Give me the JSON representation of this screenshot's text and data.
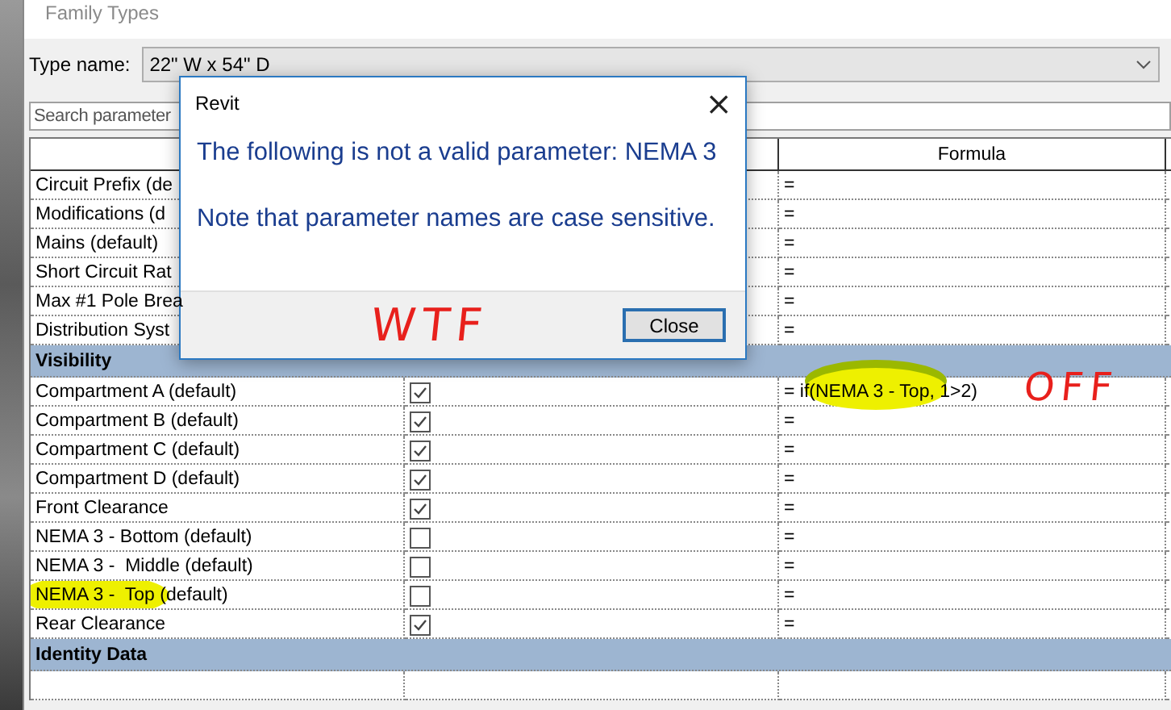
{
  "window": {
    "title": "Family Types"
  },
  "type_name": {
    "label": "Type name:",
    "value": "22\" W x 54\" D"
  },
  "search": {
    "placeholder": "Search parameter"
  },
  "table": {
    "formula_header": "Formula",
    "rows": [
      {
        "kind": "param",
        "name": "Circuit Prefix (de",
        "formula": "="
      },
      {
        "kind": "param",
        "name": "Modifications (d",
        "formula": "="
      },
      {
        "kind": "param",
        "name": "Mains (default)",
        "formula": "="
      },
      {
        "kind": "param",
        "name": "Short Circuit Rat",
        "formula": "="
      },
      {
        "kind": "param",
        "name": "Max #1 Pole Brea",
        "formula": "="
      },
      {
        "kind": "param",
        "name": "Distribution Syst",
        "formula": "="
      },
      {
        "kind": "section",
        "name": "Visibility"
      },
      {
        "kind": "check",
        "name": "Compartment A (default)",
        "checked": true,
        "formula": "= if(NEMA 3 - Top, 1>2)",
        "formula_highlight": true,
        "annotation": "OFF"
      },
      {
        "kind": "check",
        "name": "Compartment B (default)",
        "checked": true,
        "formula": "="
      },
      {
        "kind": "check",
        "name": "Compartment C (default)",
        "checked": true,
        "formula": "="
      },
      {
        "kind": "check",
        "name": "Compartment D (default)",
        "checked": true,
        "formula": "="
      },
      {
        "kind": "check",
        "name": "Front Clearance",
        "checked": true,
        "formula": "="
      },
      {
        "kind": "check",
        "name": "NEMA 3 - Bottom (default)",
        "checked": false,
        "formula": "="
      },
      {
        "kind": "check",
        "name": "NEMA 3 -  Middle (default)",
        "checked": false,
        "formula": "="
      },
      {
        "kind": "check",
        "name": "NEMA 3 -  Top (default)",
        "checked": false,
        "formula": "=",
        "name_highlight": true
      },
      {
        "kind": "check",
        "name": "Rear Clearance",
        "checked": true,
        "formula": "="
      },
      {
        "kind": "section",
        "name": "Identity Data"
      },
      {
        "kind": "empty"
      }
    ]
  },
  "modal": {
    "title": "Revit",
    "close_icon": "×",
    "message": "The following is not a valid parameter:  NEMA 3",
    "note": "Note that parameter names are case sensitive.",
    "button": "Close",
    "annotation": "WTF"
  }
}
